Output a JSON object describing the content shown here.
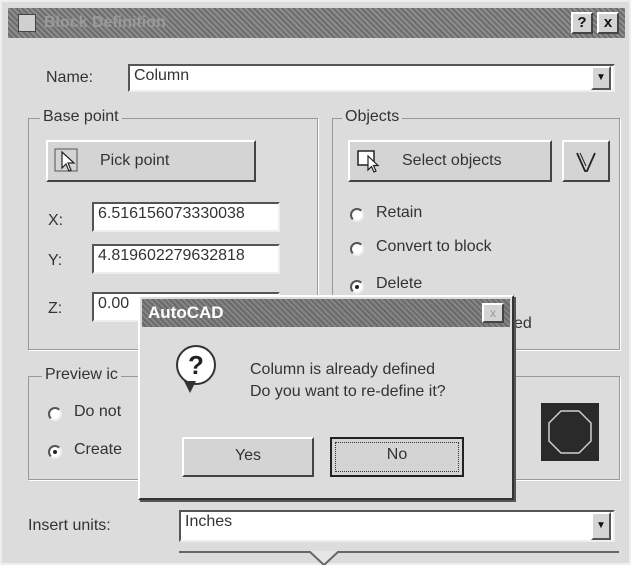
{
  "dialog": {
    "title": "Block Definition",
    "help_label": "?",
    "close_label": "x"
  },
  "name": {
    "label": "Name:",
    "value": "Column"
  },
  "base_point": {
    "group_title": "Base point",
    "pick_label": "Pick point",
    "x_label": "X:",
    "x_value": "6.516156073330038",
    "y_label": "Y:",
    "y_value": "4.819602279632818",
    "z_label": "Z:",
    "z_value": "0.00"
  },
  "objects": {
    "group_title": "Objects",
    "select_label": "Select objects",
    "retain_label": "Retain",
    "convert_label": "Convert to block",
    "delete_label": "Delete",
    "partial_label": "ed",
    "selected_option": "Delete"
  },
  "preview": {
    "group_title": "Preview ic",
    "donot_label": "Do not",
    "create_label": "Create",
    "selected_option": "Create"
  },
  "insert_units": {
    "label": "Insert units:",
    "value": "Inches"
  },
  "popup": {
    "title": "AutoCAD",
    "close_label": "x",
    "icon_glyph": "?",
    "message_line1": "Column is already defined",
    "message_line2": "Do you want to re-define it?",
    "yes_label": "Yes",
    "no_label": "No"
  },
  "icons": {
    "pick": "cursor-pick-icon",
    "select": "select-objects-icon",
    "quick_select": "quick-select-funnel-icon",
    "block_preview": "octagon-icon",
    "question": "question-bubble-icon"
  },
  "colors": {
    "titlebar": "#7a7a7a",
    "dialog_bg": "#dcdcdc",
    "preview_bg": "#2a2a2a"
  }
}
